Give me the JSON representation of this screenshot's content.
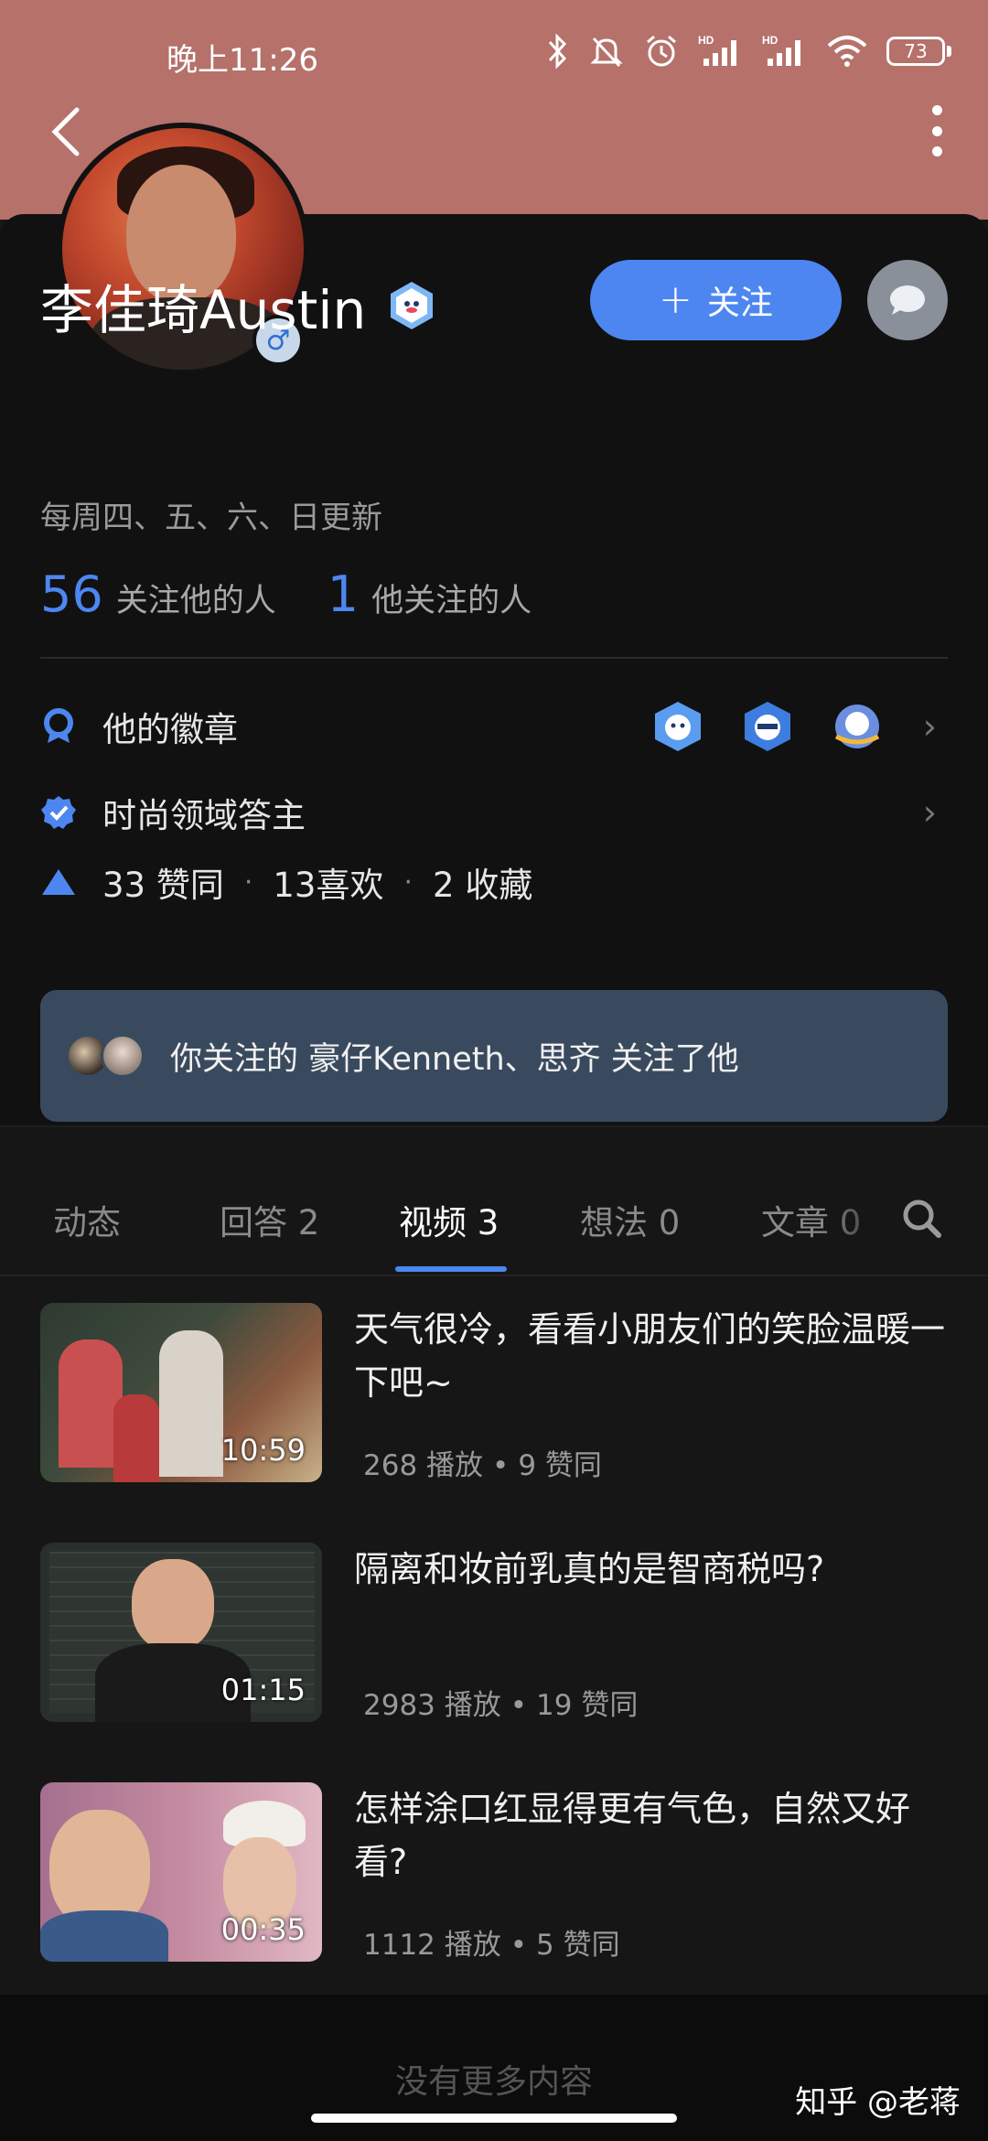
{
  "status_bar": {
    "time": "晚上11:26",
    "battery": "73"
  },
  "profile": {
    "name": "李佳琦Austin",
    "bio": "每周四、五、六、日更新",
    "followers_count": "56",
    "followers_label": "关注他的人",
    "following_count": "1",
    "following_label": "他关注的人",
    "follow_button_label": "关注"
  },
  "info_rows": {
    "badges_label": "他的徽章",
    "field_label": "时尚领域答主",
    "stats": {
      "likes": "33 赞同",
      "favorites": "13喜欢",
      "collections": "2 收藏"
    }
  },
  "followed_by": {
    "text": "你关注的 豪仔Kenneth、思齐 关注了他"
  },
  "tabs": [
    {
      "label": "动态"
    },
    {
      "label": "回答 2"
    },
    {
      "label": "视频 3"
    },
    {
      "label": "想法 0"
    },
    {
      "label": "文章 0"
    }
  ],
  "videos": [
    {
      "title": "天气很冷，看看小朋友们的笑脸温暖一下吧~",
      "duration": "10:59",
      "plays": "268 播放",
      "likes": "9 赞同"
    },
    {
      "title": "隔离和妆前乳真的是智商税吗?",
      "duration": "01:15",
      "plays": "2983 播放",
      "likes": "19 赞同"
    },
    {
      "title": "怎样涂口红显得更有气色，自然又好看?",
      "duration": "00:35",
      "plays": "1112 播放",
      "likes": "5 赞同"
    }
  ],
  "footer": {
    "end_text": "没有更多内容",
    "watermark": "知乎 @老蒋"
  },
  "colors": {
    "accent": "#4d86f0",
    "header": "#b5716a",
    "background": "#161616"
  }
}
